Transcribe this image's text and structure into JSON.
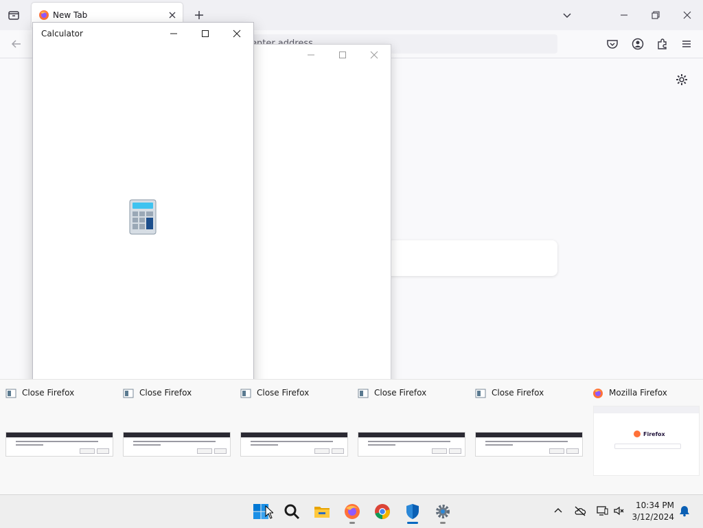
{
  "firefox": {
    "tab": {
      "title": "New Tab"
    },
    "urlbar": {
      "placeholder": "enter address"
    },
    "wordmark": "fox"
  },
  "calculator": {
    "title": "Calculator"
  },
  "thumbnails": [
    {
      "label": "Close Firefox"
    },
    {
      "label": "Close Firefox"
    },
    {
      "label": "Close Firefox"
    },
    {
      "label": "Close Firefox"
    },
    {
      "label": "Close Firefox"
    },
    {
      "label": "Mozilla Firefox",
      "preview_wordmark": "Firefox"
    }
  ],
  "taskbar": {
    "apps": [
      "start-icon",
      "search-icon",
      "file-explorer-icon",
      "firefox-icon",
      "chrome-icon",
      "defender-icon",
      "settings-icon"
    ],
    "active_app": "defender-icon",
    "clock": {
      "time": "10:34 PM",
      "date": "3/12/2024"
    }
  },
  "colors": {
    "accent": "#0067c0",
    "firefox_orange": "#ff7139",
    "wordmark": "#20123a"
  }
}
